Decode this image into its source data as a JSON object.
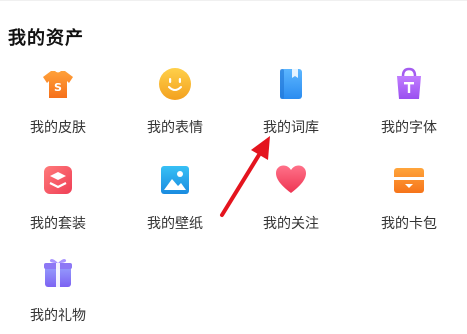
{
  "section": {
    "title": "我的资产"
  },
  "items": [
    {
      "label": "我的皮肤",
      "icon": "tshirt-icon"
    },
    {
      "label": "我的表情",
      "icon": "smiley-icon"
    },
    {
      "label": "我的词库",
      "icon": "book-icon"
    },
    {
      "label": "我的字体",
      "icon": "shopping-bag-icon"
    },
    {
      "label": "我的套装",
      "icon": "layers-icon"
    },
    {
      "label": "我的壁纸",
      "icon": "image-icon"
    },
    {
      "label": "我的关注",
      "icon": "heart-icon"
    },
    {
      "label": "我的卡包",
      "icon": "wallet-icon"
    },
    {
      "label": "我的礼物",
      "icon": "gift-icon"
    }
  ],
  "colors": {
    "orange": "#f97a20",
    "yellow": "#f5b52a",
    "blue": "#3a9df0",
    "purple": "#a45cf0",
    "red_pink": "#f04a5a",
    "light_blue": "#1fa3e8",
    "heart_red": "#f2445c",
    "annotation_red": "#e4141e"
  }
}
